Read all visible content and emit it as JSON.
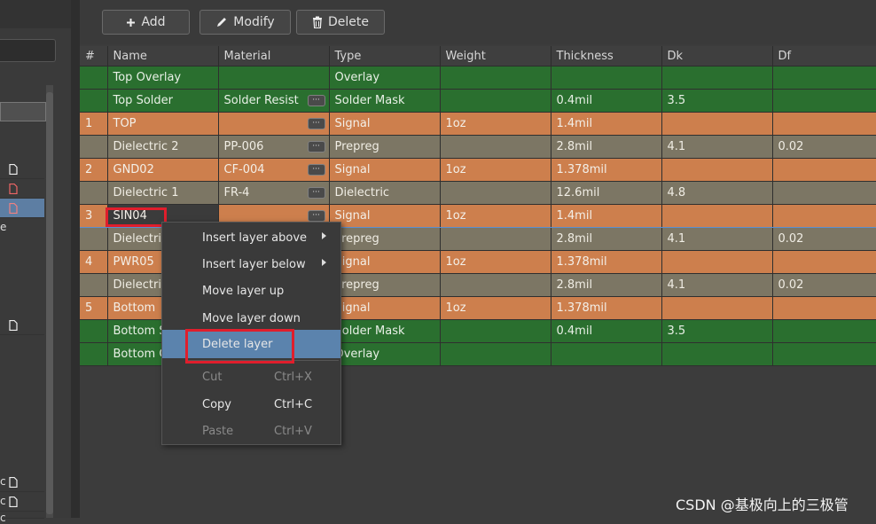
{
  "toolbar": {
    "add_label": "Add",
    "modify_label": "Modify",
    "delete_label": "Delete"
  },
  "table": {
    "columns": [
      "#",
      "Name",
      "Material",
      "Type",
      "Weight",
      "Thickness",
      "Dk",
      "Df"
    ],
    "rows": [
      {
        "num": "",
        "name": "Top Overlay",
        "material": "",
        "type": "Overlay",
        "weight": "",
        "thickness": "",
        "dk": "",
        "df": "",
        "style": "green",
        "dots": false
      },
      {
        "num": "",
        "name": "Top Solder",
        "material": "Solder Resist",
        "type": "Solder Mask",
        "weight": "",
        "thickness": "0.4mil",
        "dk": "3.5",
        "df": "",
        "style": "green",
        "dots": true
      },
      {
        "num": "1",
        "name": "TOP",
        "material": "",
        "type": "Signal",
        "weight": "1oz",
        "thickness": "1.4mil",
        "dk": "",
        "df": "",
        "style": "orange",
        "dots": true
      },
      {
        "num": "",
        "name": "Dielectric 2",
        "material": "PP-006",
        "type": "Prepreg",
        "weight": "",
        "thickness": "2.8mil",
        "dk": "4.1",
        "df": "0.02",
        "style": "gray",
        "dots": true
      },
      {
        "num": "2",
        "name": "GND02",
        "material": "CF-004",
        "type": "Signal",
        "weight": "1oz",
        "thickness": "1.378mil",
        "dk": "",
        "df": "",
        "style": "orange",
        "dots": true
      },
      {
        "num": "",
        "name": "Dielectric 1",
        "material": "FR-4",
        "type": "Dielectric",
        "weight": "",
        "thickness": "12.6mil",
        "dk": "4.8",
        "df": "",
        "style": "gray",
        "dots": true
      },
      {
        "num": "3",
        "name": "SIN04",
        "material": "",
        "type": "Signal",
        "weight": "1oz",
        "thickness": "1.4mil",
        "dk": "",
        "df": "",
        "style": "orange",
        "dots": true
      },
      {
        "num": "",
        "name": "Dielectric",
        "material": "",
        "type": "Prepreg",
        "weight": "",
        "thickness": "2.8mil",
        "dk": "4.1",
        "df": "0.02",
        "style": "gray",
        "dots": false
      },
      {
        "num": "4",
        "name": "PWR05",
        "material": "",
        "type": "Signal",
        "weight": "1oz",
        "thickness": "1.378mil",
        "dk": "",
        "df": "",
        "style": "orange",
        "dots": false
      },
      {
        "num": "",
        "name": "Dielectric",
        "material": "",
        "type": "Prepreg",
        "weight": "",
        "thickness": "2.8mil",
        "dk": "4.1",
        "df": "0.02",
        "style": "gray",
        "dots": false
      },
      {
        "num": "5",
        "name": "Bottom",
        "material": "",
        "type": "Signal",
        "weight": "1oz",
        "thickness": "1.378mil",
        "dk": "",
        "df": "",
        "style": "orange",
        "dots": false
      },
      {
        "num": "",
        "name": "Bottom S",
        "material": "",
        "type": "Solder Mask",
        "weight": "",
        "thickness": "0.4mil",
        "dk": "3.5",
        "df": "",
        "style": "green",
        "dots": false
      },
      {
        "num": "",
        "name": "Bottom O",
        "material": "",
        "type": "Overlay",
        "weight": "",
        "thickness": "",
        "dk": "",
        "df": "",
        "style": "green",
        "dots": false
      }
    ]
  },
  "context_menu": {
    "items": [
      {
        "label": "Insert layer above",
        "shortcut": "",
        "submenu": true,
        "disabled": false,
        "hover": false
      },
      {
        "label": "Insert layer below",
        "shortcut": "",
        "submenu": true,
        "disabled": false,
        "hover": false
      },
      {
        "label": "Move layer up",
        "shortcut": "",
        "submenu": false,
        "disabled": false,
        "hover": false
      },
      {
        "label": "Move layer down",
        "shortcut": "",
        "submenu": false,
        "disabled": false,
        "hover": false
      },
      {
        "label": "Delete layer",
        "shortcut": "",
        "submenu": false,
        "disabled": false,
        "hover": true
      },
      {
        "label": "Cut",
        "shortcut": "Ctrl+X",
        "submenu": false,
        "disabled": true,
        "hover": false
      },
      {
        "label": "Copy",
        "shortcut": "Ctrl+C",
        "submenu": false,
        "disabled": false,
        "hover": false
      },
      {
        "label": "Paste",
        "shortcut": "Ctrl+V",
        "submenu": false,
        "disabled": true,
        "hover": false
      }
    ]
  },
  "left_panel": {
    "partial_text_1": "e",
    "partial_text_2": "c",
    "partial_text_3": "c",
    "partial_text_4": "c"
  },
  "watermark": "CSDN @基极向上的三极管",
  "colors": {
    "signal": "#cd7f4d",
    "dielectric": "#7c7664",
    "mask": "#2a6f2f",
    "highlight": "#e01e2c",
    "menu_hover": "#5b83ad"
  }
}
